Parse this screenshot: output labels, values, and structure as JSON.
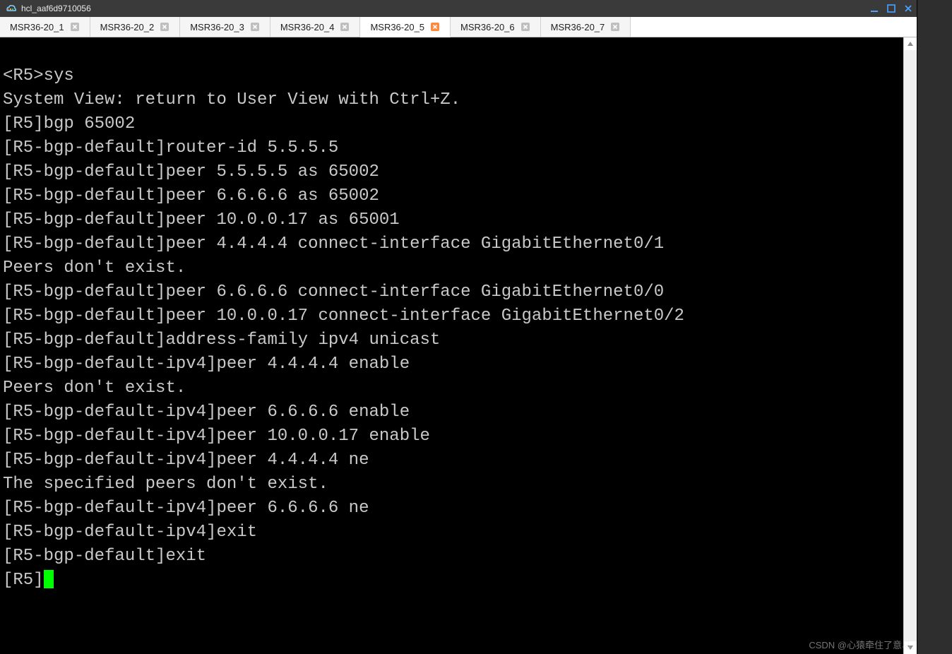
{
  "window": {
    "title": "hcl_aaf6d9710056"
  },
  "tabs": [
    {
      "label": "MSR36-20_1",
      "active": false
    },
    {
      "label": "MSR36-20_2",
      "active": false
    },
    {
      "label": "MSR36-20_3",
      "active": false
    },
    {
      "label": "MSR36-20_4",
      "active": false
    },
    {
      "label": "MSR36-20_5",
      "active": true
    },
    {
      "label": "MSR36-20_6",
      "active": false
    },
    {
      "label": "MSR36-20_7",
      "active": false
    }
  ],
  "terminal": {
    "lines": [
      "<R5>sys",
      "System View: return to User View with Ctrl+Z.",
      "[R5]bgp 65002",
      "[R5-bgp-default]router-id 5.5.5.5",
      "[R5-bgp-default]peer 5.5.5.5 as 65002",
      "[R5-bgp-default]peer 6.6.6.6 as 65002",
      "[R5-bgp-default]peer 10.0.0.17 as 65001",
      "[R5-bgp-default]peer 4.4.4.4 connect-interface GigabitEthernet0/1",
      "Peers don't exist.",
      "[R5-bgp-default]peer 6.6.6.6 connect-interface GigabitEthernet0/0",
      "[R5-bgp-default]peer 10.0.0.17 connect-interface GigabitEthernet0/2",
      "[R5-bgp-default]address-family ipv4 unicast",
      "[R5-bgp-default-ipv4]peer 4.4.4.4 enable",
      "Peers don't exist.",
      "[R5-bgp-default-ipv4]peer 6.6.6.6 enable",
      "[R5-bgp-default-ipv4]peer 10.0.0.17 enable",
      "[R5-bgp-default-ipv4]peer 4.4.4.4 ne",
      "The specified peers don't exist.",
      "[R5-bgp-default-ipv4]peer 6.6.6.6 ne",
      "[R5-bgp-default-ipv4]exit",
      "[R5-bgp-default]exit"
    ],
    "prompt": "[R5]"
  },
  "watermark": "CSDN @心猿牵住了意马",
  "colors": {
    "titlebar": "#3a3a3a",
    "tab_bg": "#f5f5f5",
    "tab_active_bg": "#ffffff",
    "terminal_bg": "#000000",
    "terminal_fg": "#c9c9c9",
    "cursor": "#00ff00",
    "close_inactive": "#bfbfbf",
    "close_active": "#ff8a3d",
    "winbtn": "#4aa3ff"
  }
}
